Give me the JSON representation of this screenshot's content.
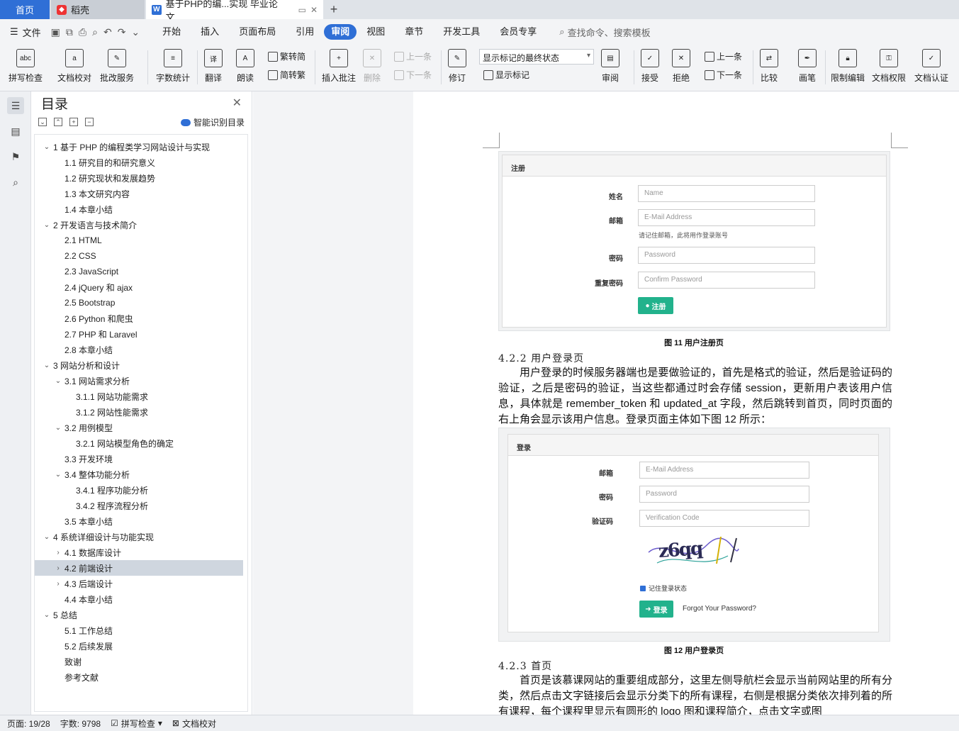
{
  "tabs": {
    "home": "首页",
    "daoke": "稻壳",
    "doc": "基于PHP的编...实现 毕业论文"
  },
  "menu": {
    "file": "文件",
    "items": [
      "开始",
      "插入",
      "页面布局",
      "引用",
      "审阅",
      "视图",
      "章节",
      "开发工具",
      "会员专享"
    ],
    "active": "审阅",
    "search": "查找命令、搜索模板"
  },
  "ribbon": {
    "spell": "拼写检查",
    "proof": "文档校对",
    "batch": "批改服务",
    "wordcount": "字数统计",
    "translate": "翻译",
    "read": "朗读",
    "s2t": "繁转简",
    "t2s": "简转繁",
    "insert_comment": "插入批注",
    "delete": "删除",
    "prev": "上一条",
    "next": "下一条",
    "revise": "修订",
    "markup_dropdown": "显示标记的最终状态",
    "show_markup": "显示标记",
    "review": "审阅",
    "accept": "接受",
    "reject": "拒绝",
    "prev2": "上一条",
    "next2": "下一条",
    "compare": "比较",
    "pen": "画笔",
    "restrict": "限制编辑",
    "rights": "文档权限",
    "cert": "文档认证"
  },
  "toc": {
    "title": "目录",
    "smart": "智能识别目录",
    "items": [
      {
        "text": "1  基于 PHP 的编程类学习网站设计与实现",
        "level": 0,
        "arrow": "⌄"
      },
      {
        "text": "1.1  研究目的和研究意义",
        "level": 1,
        "arrow": ""
      },
      {
        "text": "1.2  研究现状和发展趋势",
        "level": 1,
        "arrow": ""
      },
      {
        "text": "1.3  本文研究内容",
        "level": 1,
        "arrow": ""
      },
      {
        "text": "1.4  本章小结",
        "level": 1,
        "arrow": ""
      },
      {
        "text": "2  开发语言与技术简介",
        "level": 0,
        "arrow": "⌄"
      },
      {
        "text": "2.1 HTML",
        "level": 1,
        "arrow": ""
      },
      {
        "text": "2.2 CSS",
        "level": 1,
        "arrow": ""
      },
      {
        "text": "2.3 JavaScript",
        "level": 1,
        "arrow": ""
      },
      {
        "text": "2.4 jQuery 和 ajax",
        "level": 1,
        "arrow": ""
      },
      {
        "text": "2.5 Bootstrap",
        "level": 1,
        "arrow": ""
      },
      {
        "text": "2.6 Python 和爬虫",
        "level": 1,
        "arrow": ""
      },
      {
        "text": "2.7 PHP 和 Laravel",
        "level": 1,
        "arrow": ""
      },
      {
        "text": "2.8  本章小结",
        "level": 1,
        "arrow": ""
      },
      {
        "text": "3  网站分析和设计",
        "level": 0,
        "arrow": "⌄"
      },
      {
        "text": "3.1  网站需求分析",
        "level": 1,
        "arrow": "⌄"
      },
      {
        "text": "3.1.1  网站功能需求",
        "level": 2,
        "arrow": ""
      },
      {
        "text": "3.1.2  网站性能需求",
        "level": 2,
        "arrow": ""
      },
      {
        "text": "3.2  用例模型",
        "level": 1,
        "arrow": "⌄"
      },
      {
        "text": "3.2.1 网站模型角色的确定",
        "level": 2,
        "arrow": ""
      },
      {
        "text": "3.3  开发环境",
        "level": 1,
        "arrow": ""
      },
      {
        "text": "3.4  整体功能分析",
        "level": 1,
        "arrow": "⌄"
      },
      {
        "text": "3.4.1  程序功能分析",
        "level": 2,
        "arrow": ""
      },
      {
        "text": "3.4.2  程序流程分析",
        "level": 2,
        "arrow": ""
      },
      {
        "text": "3.5  本章小结",
        "level": 1,
        "arrow": ""
      },
      {
        "text": "4  系统详细设计与功能实现",
        "level": 0,
        "arrow": "⌄"
      },
      {
        "text": "4.1  数据库设计",
        "level": 1,
        "arrow": "›"
      },
      {
        "text": "4.2  前端设计",
        "level": 1,
        "arrow": "›",
        "selected": true
      },
      {
        "text": "4.3  后端设计",
        "level": 1,
        "arrow": "›"
      },
      {
        "text": "4.4  本章小结",
        "level": 1,
        "arrow": ""
      },
      {
        "text": "5  总结",
        "level": 0,
        "arrow": "⌄"
      },
      {
        "text": "5.1  工作总结",
        "level": 1,
        "arrow": ""
      },
      {
        "text": "5.2  后续发展",
        "level": 1,
        "arrow": ""
      },
      {
        "text": "致谢",
        "level": 1,
        "arrow": ""
      },
      {
        "text": "参考文献",
        "level": 1,
        "arrow": ""
      }
    ]
  },
  "doc": {
    "reg": {
      "header": "注册",
      "name_label": "姓名",
      "name_ph": "Name",
      "email_label": "邮箱",
      "email_ph": "E-Mail Address",
      "email_help": "请记住邮箱，此将用作登录账号",
      "pwd_label": "密码",
      "pwd_ph": "Password",
      "confirm_label": "重复密码",
      "confirm_ph": "Confirm Password",
      "btn": "注册",
      "caption": "图 11  用户注册页"
    },
    "h_422": "4.2.2  用户登录页",
    "p_422": "用户登录的时候服务器端也是要做验证的，首先是格式的验证，然后是验证码的验证，之后是密码的验证，当这些都通过时会存储 session，更新用户表该用户信息，具体就是 remember_token 和 updated_at 字段，然后跳转到首页，同时页面的右上角会显示该用户信息。登录页面主体如下图 12 所示：",
    "login": {
      "header": "登录",
      "email_label": "邮箱",
      "email_ph": "E-Mail Address",
      "pwd_label": "密码",
      "pwd_ph": "Password",
      "code_label": "验证码",
      "code_ph": "Verification Code",
      "captcha": "z6qq",
      "remember": "记住登录状态",
      "btn": "登录",
      "forgot": "Forgot Your Password?",
      "caption": "图 12  用户登录页"
    },
    "h_423": "4.2.3  首页",
    "p_423": "首页是该慕课网站的重要组成部分，这里左侧导航栏会显示当前网站里的所有分类，然后点击文字链接后会显示分类下的所有课程，右侧是根据分类依次排列着的所有课程，每个课程里显示有圆形的 logo 图和课程简介，点击文字或图"
  },
  "status": {
    "page": "页面: 19/28",
    "words": "字数: 9798",
    "spell": "拼写检查",
    "proof": "文档校对"
  }
}
